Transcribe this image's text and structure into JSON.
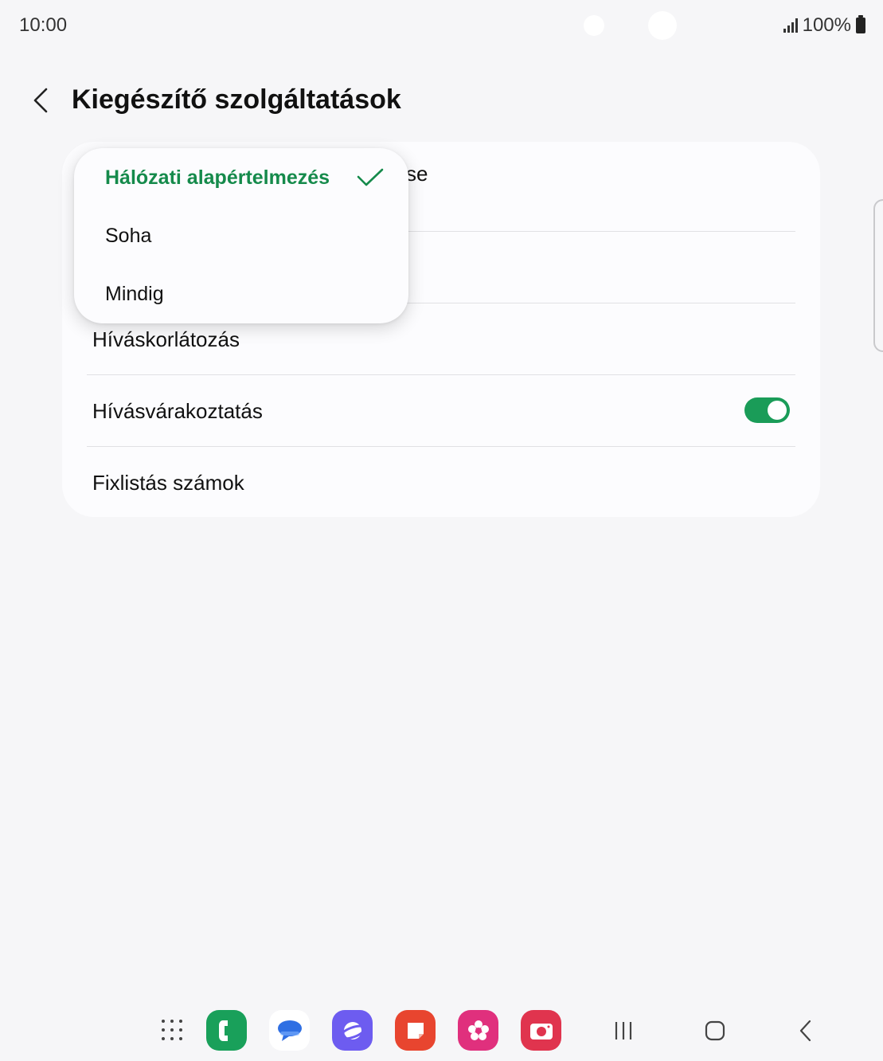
{
  "status_bar": {
    "time": "10:00",
    "battery": "100%"
  },
  "header": {
    "back_icon": "chevron-left-icon",
    "title": "Kiegészítő szolgáltatások"
  },
  "settings": {
    "row1_tail": "se",
    "rows": [
      {
        "label": "Hívásk­orlátozás"
      },
      {
        "label": "Hívásvárakoztatás",
        "toggle_on": true
      },
      {
        "label": "Fixlistás számok"
      }
    ]
  },
  "popup": {
    "options": [
      {
        "label": "Hálózati alapértelmezés",
        "selected": true
      },
      {
        "label": "Soha",
        "selected": false
      },
      {
        "label": "Mindig",
        "selected": false
      }
    ]
  },
  "dock": {
    "apps": [
      "apps-grid-icon",
      "phone-icon",
      "messages-icon",
      "internet-icon",
      "notes-icon",
      "gallery-icon",
      "camera-icon"
    ]
  },
  "navigation": [
    "recents-icon",
    "home-icon",
    "back-icon"
  ],
  "colors": {
    "accent": "#158a4b",
    "toggle": "#1a9c58",
    "background": "#f6f6f8"
  }
}
